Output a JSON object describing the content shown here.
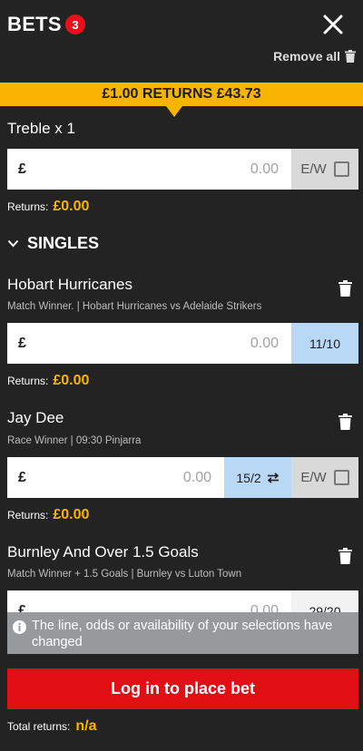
{
  "header": {
    "title": "BETS",
    "count": "3",
    "remove_all": "Remove all"
  },
  "banner": {
    "text": "£1.00 RETURNS £43.73"
  },
  "multiple": {
    "title": "Treble x 1",
    "currency": "£",
    "stake_placeholder": "0.00",
    "ew_label": "E/W",
    "returns_label": "Returns:",
    "returns_value": "£0.00"
  },
  "singles": {
    "label": "SINGLES",
    "bets": [
      {
        "title": "Hobart Hurricanes",
        "subtitle": "Match Winner.  |  Hobart Hurricanes vs Adelaide Strikers",
        "currency": "£",
        "stake_placeholder": "0.00",
        "odds": "11/10",
        "returns_label": "Returns:",
        "returns_value": "£0.00"
      },
      {
        "title": "Jay Dee",
        "subtitle": "Race Winner  |  09:30 Pinjarra",
        "currency": "£",
        "stake_placeholder": "0.00",
        "odds": "15/2",
        "ew_label": "E/W",
        "returns_label": "Returns:",
        "returns_value": "£0.00"
      },
      {
        "title": "Burnley And Over 1.5 Goals",
        "subtitle": "Match Winner + 1.5 Goals  |  Burnley vs Luton Town",
        "currency": "£",
        "stake_placeholder": "0.00",
        "odds": "29/20"
      }
    ]
  },
  "notice": {
    "text": "The line, odds or availability of your selections have changed"
  },
  "footer": {
    "login_button": "Log in to place bet",
    "total_returns_label": "Total returns:",
    "total_returns_value": "n/a"
  },
  "colors": {
    "background": "#232323",
    "accent_yellow": "#f8b400",
    "primary_red": "#e10f14",
    "odds_blue": "#b9d8f6"
  }
}
